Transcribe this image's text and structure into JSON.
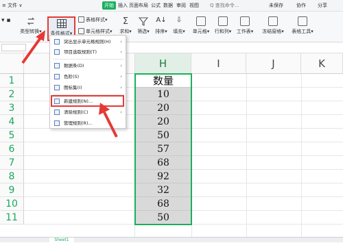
{
  "menubar": {
    "items": [
      "≡ 文件 ∨",
      "开始",
      "插入",
      "页面布局",
      "公式",
      "数据",
      "审阅",
      "视图",
      "Q 查找命令...",
      "未保存",
      "协作",
      "分享"
    ],
    "active_tab": "开始"
  },
  "ribbon": {
    "type_convert": "类型转换▾",
    "cond_format": "条件格式▾",
    "table_style": "表格样式▾",
    "cell_style": "单元格样式▾",
    "sum": "求和▾",
    "filter": "筛选▾",
    "sort": "排序▾",
    "fill": "填充▾",
    "cell": "单元格▾",
    "row_col": "行和列▾",
    "worksheet": "工作表▾",
    "freeze": "冻结窗格▾",
    "table_tools": "表格工具▾"
  },
  "columns": {
    "h": "H",
    "i": "I",
    "j": "J",
    "k": "K"
  },
  "rows": [
    "1",
    "2",
    "3",
    "4",
    "5",
    "6",
    "7",
    "8",
    "9",
    "10",
    "11"
  ],
  "column_h": {
    "header": "数量",
    "values": [
      "10",
      "20",
      "20",
      "50",
      "57",
      "68",
      "92",
      "32",
      "68",
      "50"
    ]
  },
  "context_menu": {
    "items": [
      {
        "label": "突出显示单元格规则(H)",
        "submenu": true
      },
      {
        "label": "项目选取规则(T)",
        "submenu": true
      },
      {
        "label": "数据条(D)",
        "submenu": true
      },
      {
        "label": "色阶(S)",
        "submenu": true
      },
      {
        "label": "图标集(I)",
        "submenu": true
      },
      {
        "label": "新建规则(N)...",
        "submenu": false
      },
      {
        "label": "清除规则(C)",
        "submenu": true
      },
      {
        "label": "管理规则(R)...",
        "submenu": false
      }
    ]
  },
  "sheet_tab": "Sheet1",
  "colors": {
    "accent_green": "#1aaf5d",
    "highlight_red": "#e53935",
    "selected_cell_fill": "#d9d9d9"
  }
}
